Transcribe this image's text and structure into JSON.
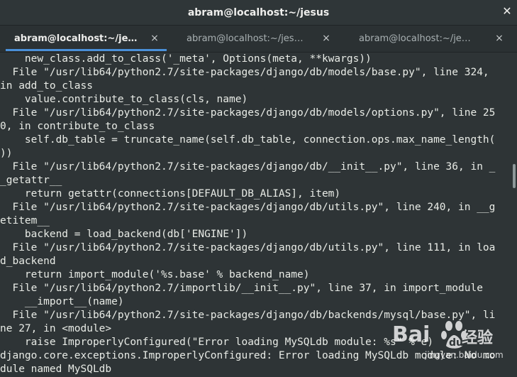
{
  "window": {
    "title": "abram@localhost:~/jesus",
    "close_symbol": "✕"
  },
  "tabs": [
    {
      "label": "abram@localhost:~/je…",
      "close": "×",
      "active": true
    },
    {
      "label": "abram@localhost:~/jes…",
      "close": "×",
      "active": false
    },
    {
      "label": "abram@localhost:~/je…",
      "close": "×",
      "active": false
    }
  ],
  "terminal": {
    "lines": [
      "    new_class.add_to_class('_meta', Options(meta, **kwargs))",
      "  File \"/usr/lib64/python2.7/site-packages/django/db/models/base.py\", line 324,",
      "in add_to_class",
      "    value.contribute_to_class(cls, name)",
      "  File \"/usr/lib64/python2.7/site-packages/django/db/models/options.py\", line 25",
      "0, in contribute_to_class",
      "    self.db_table = truncate_name(self.db_table, connection.ops.max_name_length(",
      "))",
      "  File \"/usr/lib64/python2.7/site-packages/django/db/__init__.py\", line 36, in _",
      "_getattr__",
      "    return getattr(connections[DEFAULT_DB_ALIAS], item)",
      "  File \"/usr/lib64/python2.7/site-packages/django/db/utils.py\", line 240, in __g",
      "etitem__",
      "    backend = load_backend(db['ENGINE'])",
      "  File \"/usr/lib64/python2.7/site-packages/django/db/utils.py\", line 111, in loa",
      "d_backend",
      "    return import_module('%s.base' % backend_name)",
      "  File \"/usr/lib64/python2.7/importlib/__init__.py\", line 37, in import_module",
      "    __import__(name)",
      "  File \"/usr/lib64/python2.7/site-packages/django/db/backends/mysql/base.py\", li",
      "ne 27, in <module>",
      "    raise ImproperlyConfigured(\"Error loading MySQLdb module: %s\" % e)",
      "django.core.exceptions.ImproperlyConfigured: Error loading MySQLdb module: No mo",
      "dule named MySQLdb"
    ]
  },
  "watermark": {
    "brand": "Bai",
    "suffix": "经验",
    "url": "jingyan.baidu.com"
  },
  "colors": {
    "terminal_bg": "#2e3436",
    "terminal_fg": "#e8ebe6",
    "active_tab_accent": "#4a90d9"
  }
}
